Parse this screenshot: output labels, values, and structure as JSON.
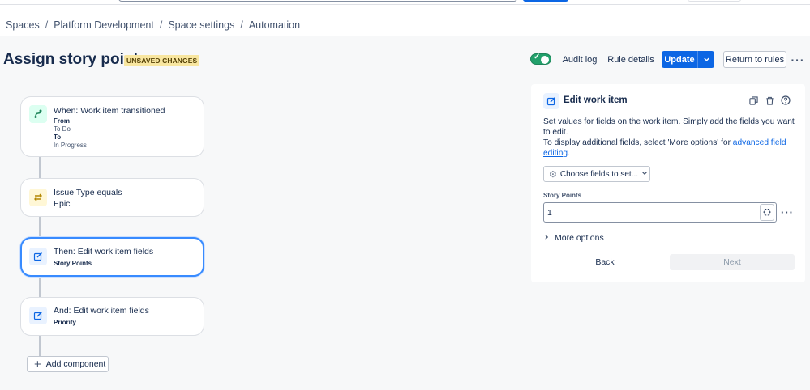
{
  "breadcrumb": {
    "items": [
      "Spaces",
      "Platform Development",
      "Space settings",
      "Automation"
    ],
    "separator": "/"
  },
  "header": {
    "title": "Assign story points",
    "status_badge": "UNSAVED CHANGES",
    "toggle_enabled": true,
    "audit_log": "Audit log",
    "rule_details": "Rule details",
    "update": "Update",
    "return_to_rules": "Return to rules"
  },
  "flow": {
    "cards": [
      {
        "icon": "branch-trigger-icon",
        "title": "When: Work item transitioned",
        "from_label": "From",
        "from_value": "To Do",
        "to_label": "To",
        "to_value": "In Progress"
      },
      {
        "icon": "condition-swap-icon",
        "title": "Issue Type equals",
        "value": "Epic"
      },
      {
        "icon": "edit-icon",
        "title": "Then: Edit work item fields",
        "value": "Story Points",
        "selected": true
      },
      {
        "icon": "edit-icon",
        "title": "And: Edit work item fields",
        "value": "Priority"
      }
    ],
    "add_component": "Add component"
  },
  "panel": {
    "title": "Edit work item",
    "desc_line1": "Set values for fields on the work item. Simply add the fields you want to edit.",
    "desc_line2_prefix": "To display additional fields, select 'More options' for ",
    "desc_link": "advanced field editing",
    "desc_line2_suffix": ".",
    "choose_fields": "Choose fields to set...",
    "field_label": "Story Points",
    "field_value": "1",
    "smart_value_button": "{}",
    "more_options": "More options",
    "back": "Back",
    "next": "Next"
  },
  "colors": {
    "primary": "#0c66e4",
    "toggle_on": "#22a06b",
    "badge_bg": "#f8e6a0",
    "selected_border": "#388bff"
  }
}
